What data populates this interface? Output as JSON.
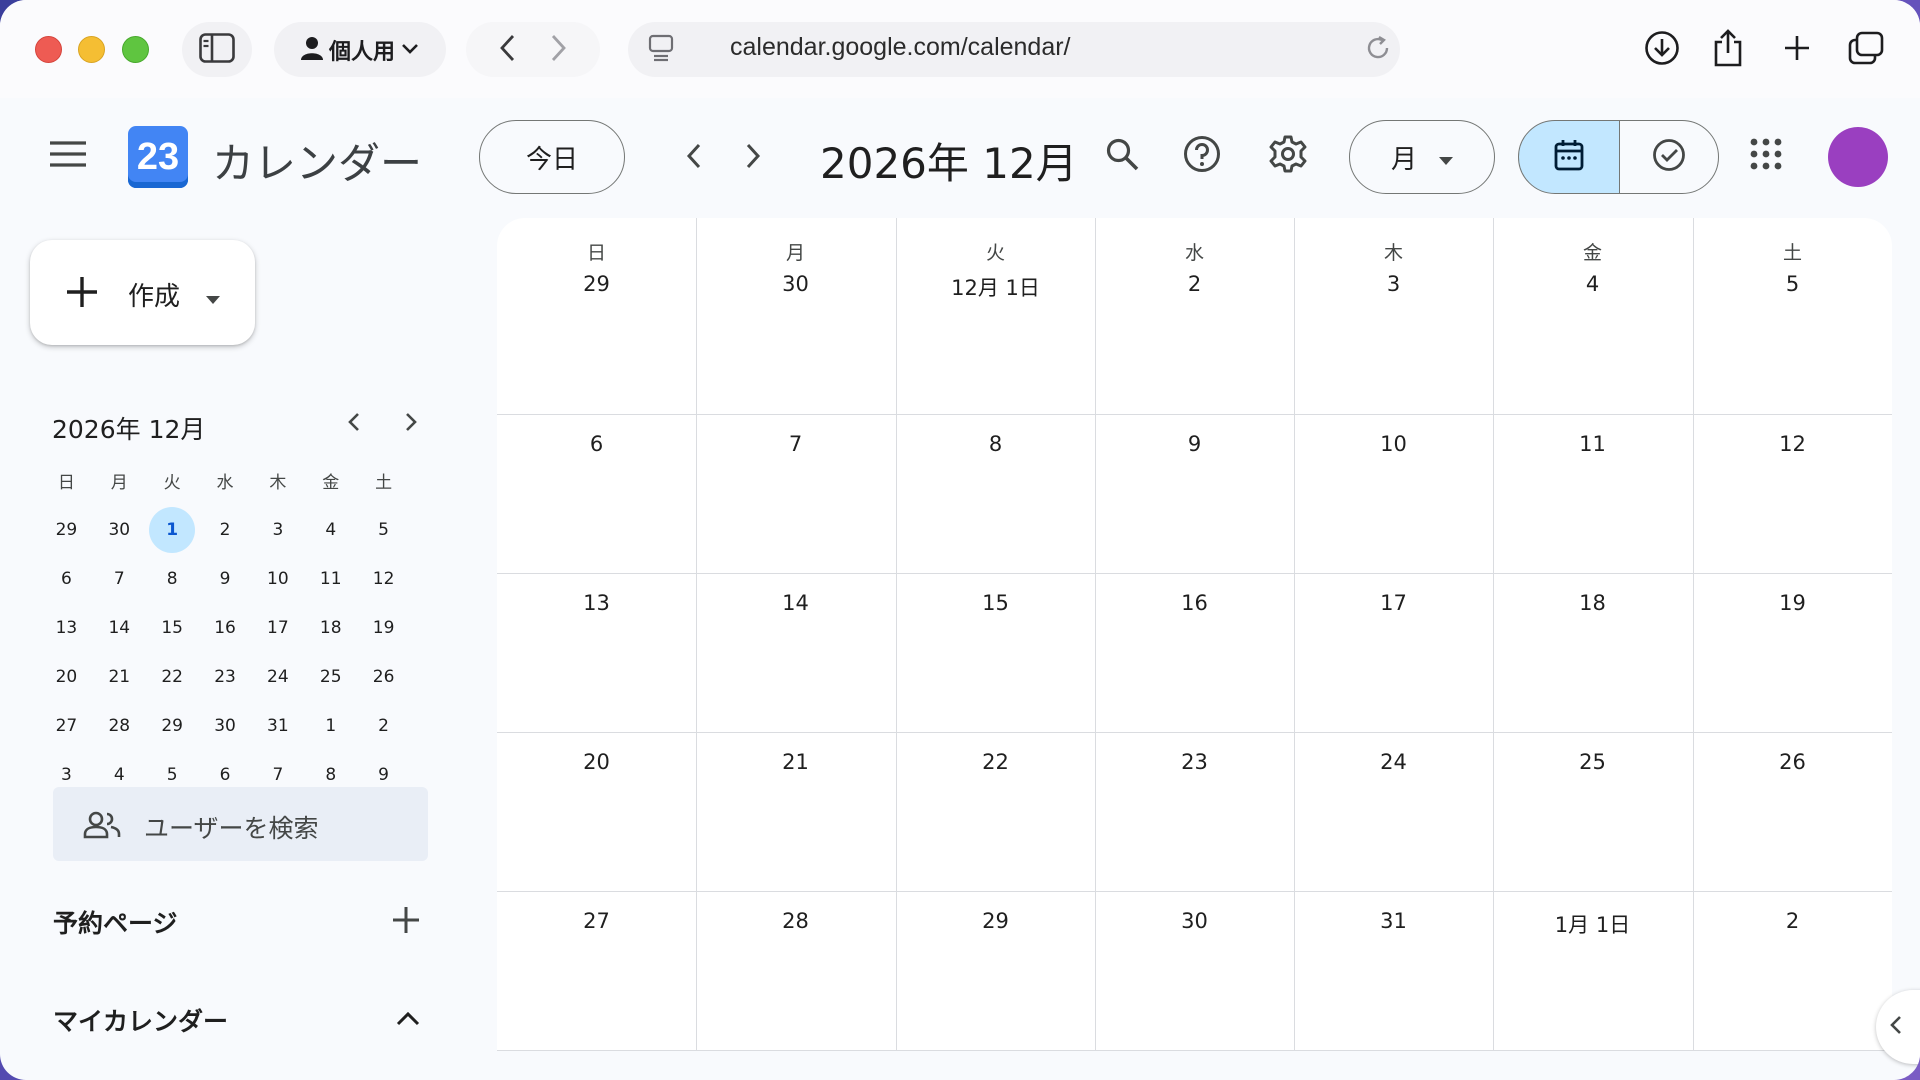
{
  "browser": {
    "profile_label": "個人用",
    "url": "calendar.google.com/calendar/"
  },
  "header": {
    "logo_text": "23",
    "app_title": "カレンダー",
    "today_label": "今日",
    "period_title": "2026年 12月",
    "view_label": "月"
  },
  "sidebar": {
    "create_label": "作成",
    "mini_calendar": {
      "title": "2026年 12月",
      "weekdays": [
        "日",
        "月",
        "火",
        "水",
        "木",
        "金",
        "土"
      ],
      "weeks": [
        [
          "29",
          "30",
          "1",
          "2",
          "3",
          "4",
          "5"
        ],
        [
          "6",
          "7",
          "8",
          "9",
          "10",
          "11",
          "12"
        ],
        [
          "13",
          "14",
          "15",
          "16",
          "17",
          "18",
          "19"
        ],
        [
          "20",
          "21",
          "22",
          "23",
          "24",
          "25",
          "26"
        ],
        [
          "27",
          "28",
          "29",
          "30",
          "31",
          "1",
          "2"
        ],
        [
          "3",
          "4",
          "5",
          "6",
          "7",
          "8",
          "9"
        ]
      ],
      "today_label": "1"
    },
    "search_users_placeholder": "ユーザーを検索",
    "booking_pages_label": "予約ページ",
    "my_calendars_label": "マイカレンダー"
  },
  "month_view": {
    "weekdays": [
      "日",
      "月",
      "火",
      "水",
      "木",
      "金",
      "土"
    ],
    "weeks": [
      [
        "29",
        "30",
        "12月 1日",
        "2",
        "3",
        "4",
        "5"
      ],
      [
        "6",
        "7",
        "8",
        "9",
        "10",
        "11",
        "12"
      ],
      [
        "13",
        "14",
        "15",
        "16",
        "17",
        "18",
        "19"
      ],
      [
        "20",
        "21",
        "22",
        "23",
        "24",
        "25",
        "26"
      ],
      [
        "27",
        "28",
        "29",
        "30",
        "31",
        "1月 1日",
        "2"
      ]
    ]
  },
  "colors": {
    "accent": "#c2e7ff",
    "primary": "#0b57d0",
    "logo_blue": "#4285f4",
    "avatar": "#9a3fc0"
  }
}
